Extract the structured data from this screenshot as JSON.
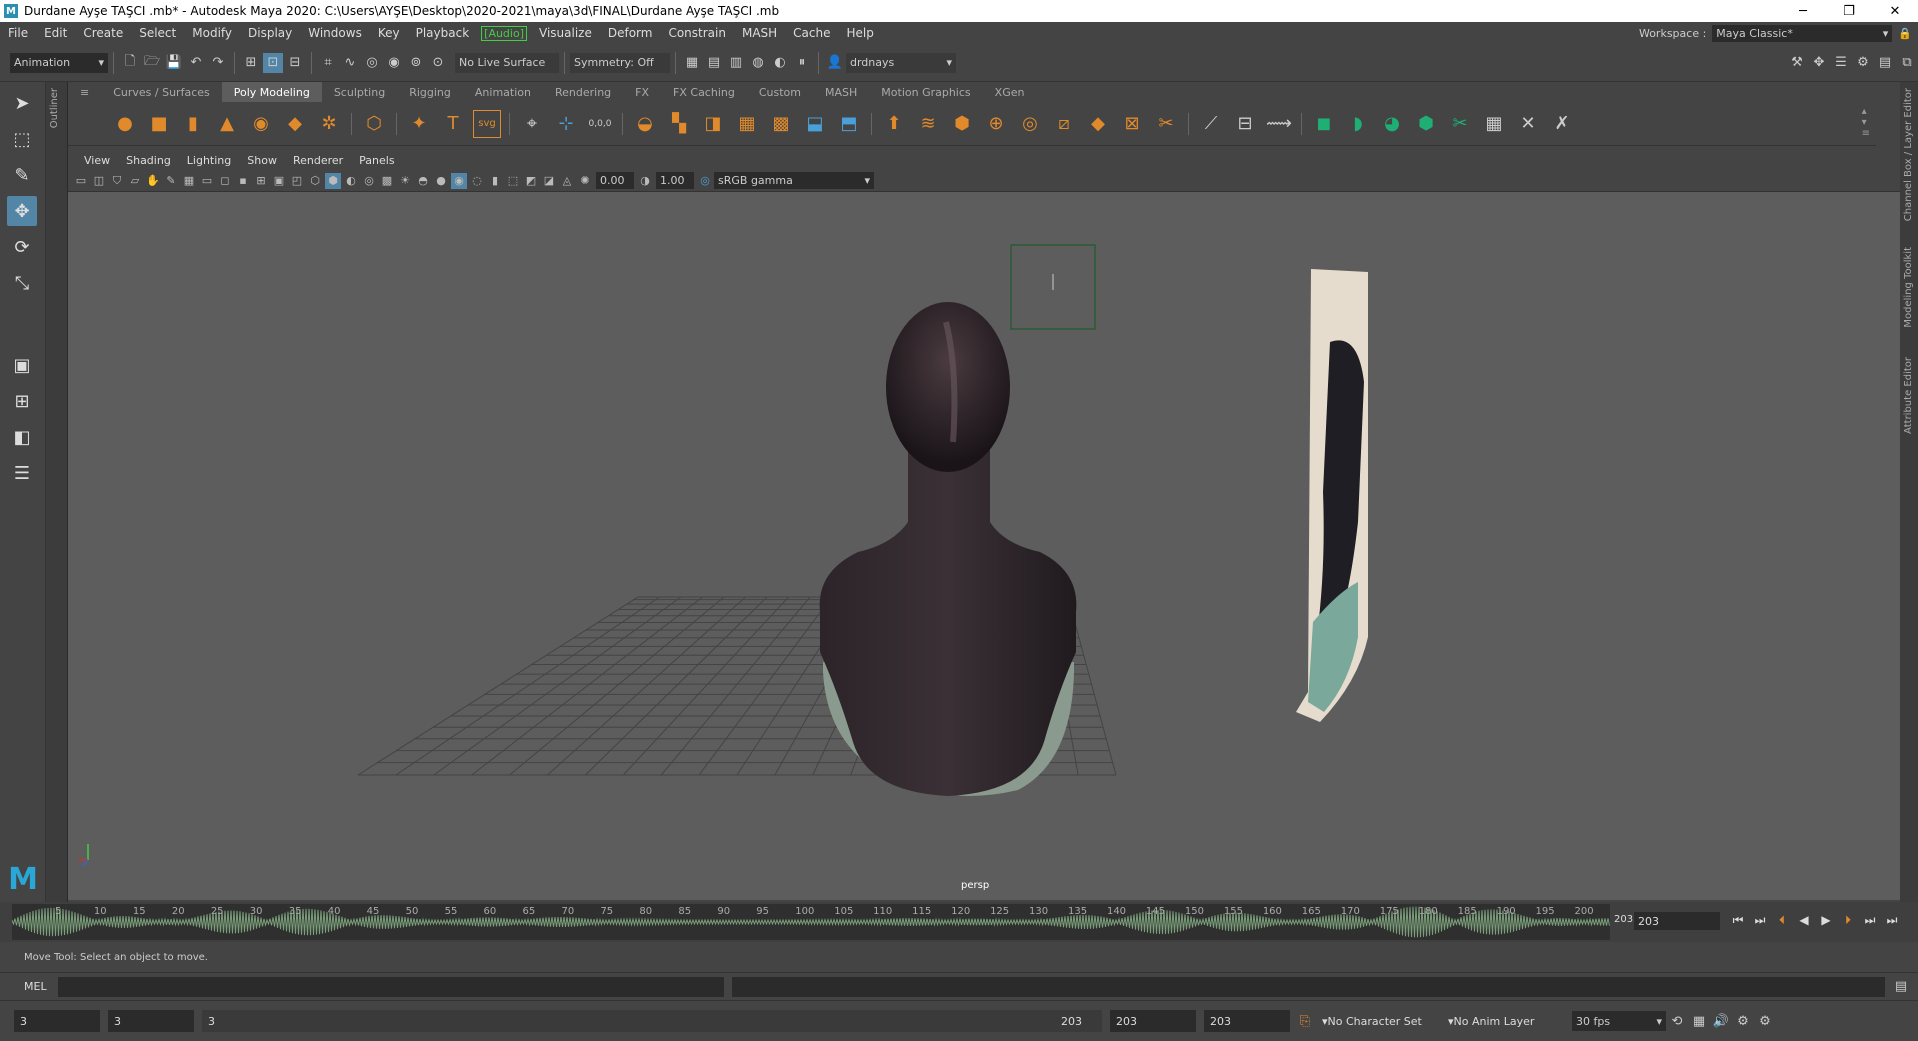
{
  "titlebar": {
    "title": "Durdane Ayşe TAŞCI .mb* - Autodesk Maya 2020: C:\\Users\\AYŞE\\Desktop\\2020-2021\\maya\\3d\\FINAL\\Durdane Ayşe TAŞCI .mb",
    "logo": "M",
    "min": "─",
    "restore": "❐",
    "close": "✕"
  },
  "menubar": {
    "items": [
      "File",
      "Edit",
      "Create",
      "Select",
      "Modify",
      "Display",
      "Windows",
      "Key",
      "Playback"
    ],
    "audio": "Audio",
    "items2": [
      "Visualize",
      "Deform",
      "Constrain",
      "MASH",
      "Cache",
      "Help"
    ],
    "workspace_label": "Workspace :",
    "workspace_value": "Maya Classic*"
  },
  "statusline": {
    "mode": "Animation",
    "live_surface": "No Live Surface",
    "symmetry": "Symmetry: Off",
    "user": "drdnays"
  },
  "outliner_label": "Outliner",
  "shelf": {
    "tabs": [
      "Curves / Surfaces",
      "Poly Modeling",
      "Sculpting",
      "Rigging",
      "Animation",
      "Rendering",
      "FX",
      "FX Caching",
      "Custom",
      "MASH",
      "Motion Graphics",
      "XGen"
    ],
    "active": "Poly Modeling",
    "svg_label": "svg",
    "text_label": "T",
    "num_label": "0,0,0"
  },
  "panel": {
    "menus": [
      "View",
      "Shading",
      "Lighting",
      "Show",
      "Renderer",
      "Panels"
    ],
    "exposure": "0.00",
    "gamma": "1.00",
    "color_space": "sRGB gamma",
    "camera": "persp"
  },
  "right_tabs": [
    "Channel Box / Layer Editor",
    "Modeling Toolkit",
    "Attribute Editor"
  ],
  "timeline": {
    "ticks": [
      "5",
      "10",
      "15",
      "20",
      "25",
      "30",
      "35",
      "40",
      "45",
      "50",
      "55",
      "60",
      "65",
      "70",
      "75",
      "80",
      "85",
      "90",
      "95",
      "100",
      "105",
      "110",
      "115",
      "120",
      "125",
      "130",
      "135",
      "140",
      "145",
      "150",
      "155",
      "160",
      "165",
      "170",
      "175",
      "180",
      "185",
      "190",
      "195",
      "200"
    ],
    "current": "203",
    "frame_field": "203"
  },
  "helpline": "Move Tool: Select an object to move.",
  "cmd": {
    "label": "MEL"
  },
  "range": {
    "start": "3",
    "anim_start": "3",
    "slider_start": "3",
    "slider_end": "203",
    "anim_end": "203",
    "end": "203",
    "char_set": "No Character Set",
    "anim_layer": "No Anim Layer",
    "fps": "30 fps"
  },
  "colors": {
    "accent": "#5285a6",
    "shelf_orange": "#e08a2c",
    "audio_green": "#44cc44",
    "wave_green": "#7a9f7a"
  }
}
